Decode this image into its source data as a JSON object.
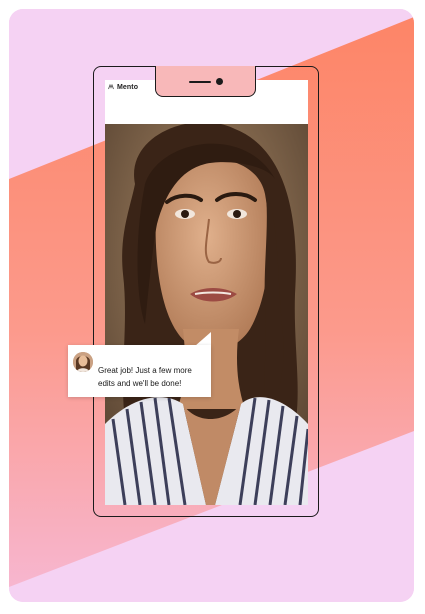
{
  "app": {
    "name": "Mento",
    "logo_icon": "mento-logo-icon"
  },
  "chat": {
    "message": "Great job! Just a few more edits and we'll be done!",
    "avatar_icon": "coach-avatar"
  },
  "colors": {
    "card_pink": "#f5d2f3",
    "card_coral": "#fd8a6b",
    "card_light_pink": "#f7b3c7",
    "phone_outline": "#1b1b1b"
  },
  "video": {
    "subject": "video-call-portrait"
  }
}
